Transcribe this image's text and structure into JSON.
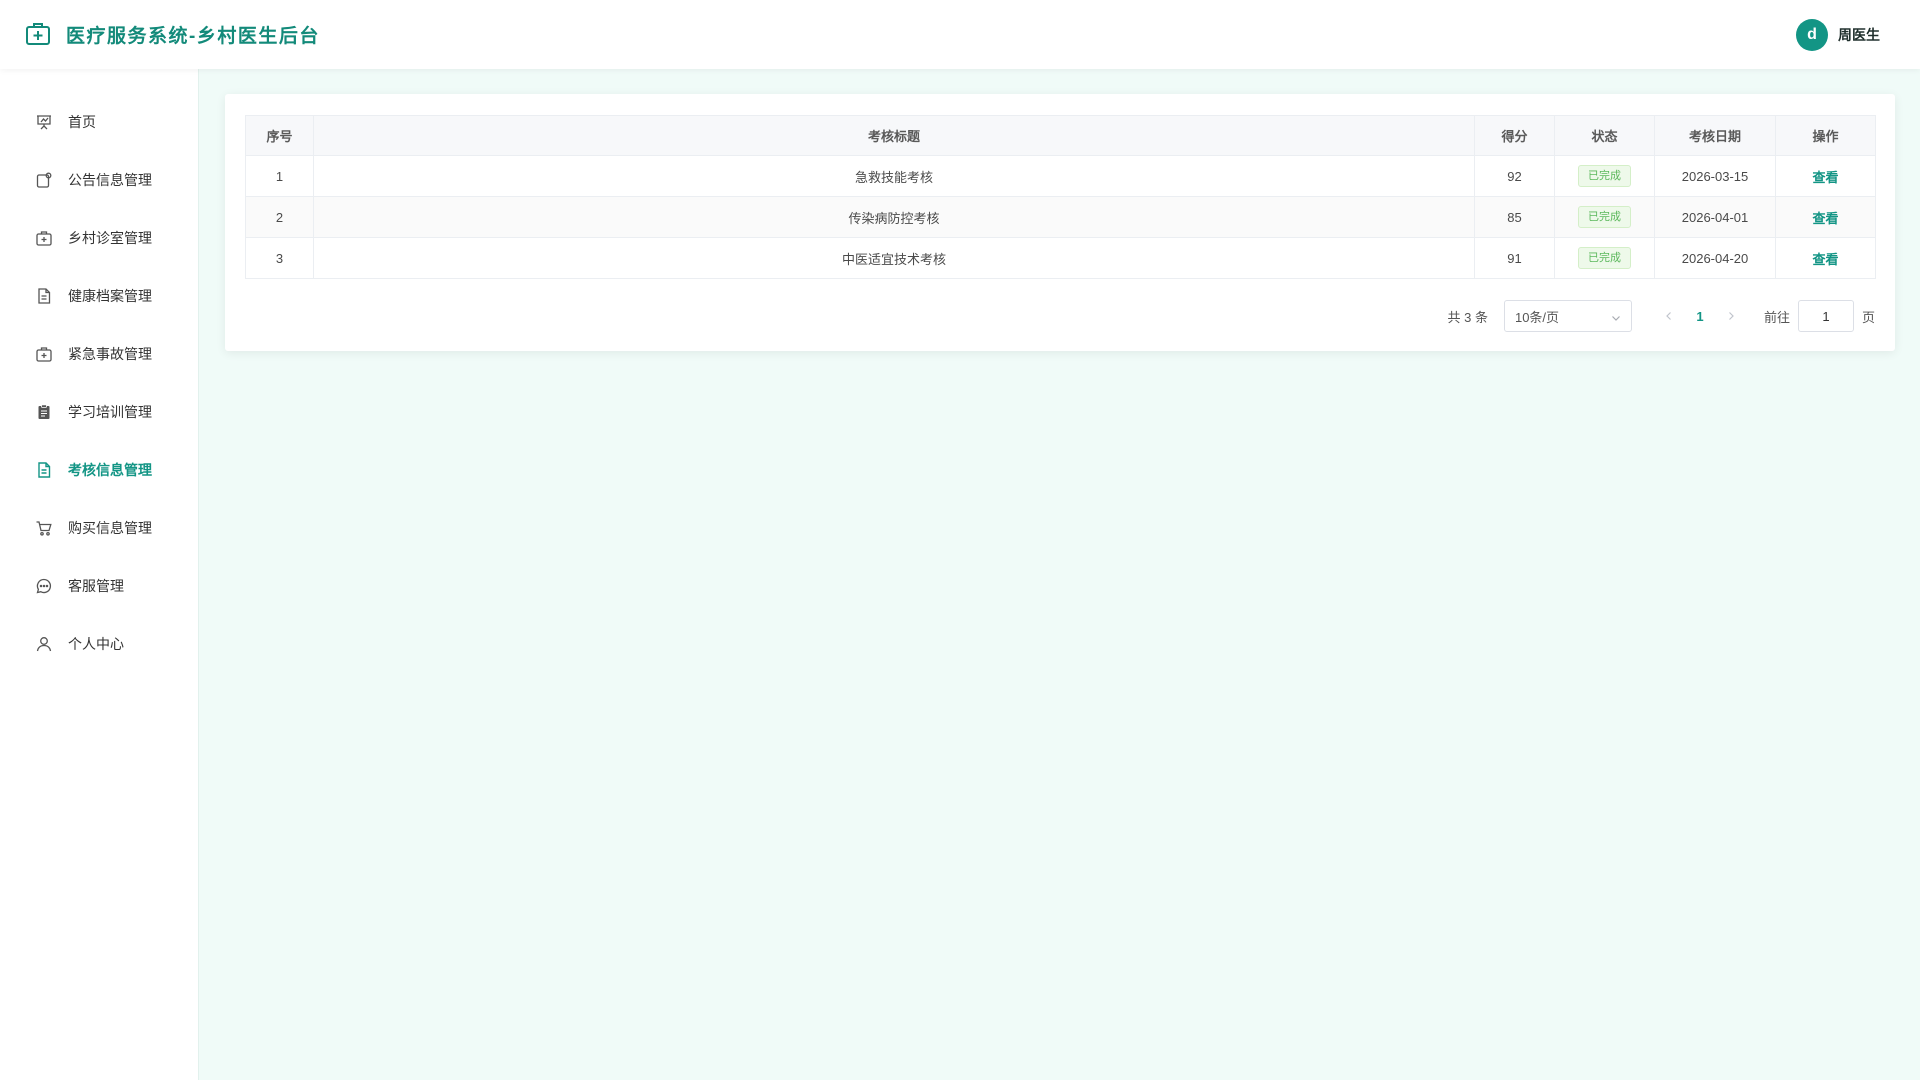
{
  "header": {
    "title": "医疗服务系统-乡村医生后台",
    "user": {
      "avatar_letter": "d",
      "name": "周医生"
    }
  },
  "sidebar": {
    "items": [
      {
        "label": "首页",
        "icon": "presentation-icon",
        "active": false
      },
      {
        "label": "公告信息管理",
        "icon": "notice-icon",
        "active": false
      },
      {
        "label": "乡村诊室管理",
        "icon": "medical-kit-icon",
        "active": false
      },
      {
        "label": "健康档案管理",
        "icon": "document-icon",
        "active": false
      },
      {
        "label": "紧急事故管理",
        "icon": "first-aid-icon",
        "active": false
      },
      {
        "label": "学习培训管理",
        "icon": "clipboard-icon",
        "active": false
      },
      {
        "label": "考核信息管理",
        "icon": "document-icon",
        "active": true
      },
      {
        "label": "购买信息管理",
        "icon": "cart-icon",
        "active": false
      },
      {
        "label": "客服管理",
        "icon": "chat-icon",
        "active": false
      },
      {
        "label": "个人中心",
        "icon": "user-icon",
        "active": false
      }
    ]
  },
  "table": {
    "headers": [
      "序号",
      "考核标题",
      "得分",
      "状态",
      "考核日期",
      "操作"
    ],
    "rows": [
      {
        "index": "1",
        "title": "急救技能考核",
        "score": "92",
        "status": "已完成",
        "date": "2026-03-15",
        "action": "查看"
      },
      {
        "index": "2",
        "title": "传染病防控考核",
        "score": "85",
        "status": "已完成",
        "date": "2026-04-01",
        "action": "查看"
      },
      {
        "index": "3",
        "title": "中医适宜技术考核",
        "score": "91",
        "status": "已完成",
        "date": "2026-04-20",
        "action": "查看"
      }
    ]
  },
  "pagination": {
    "total_text": "共 3 条",
    "page_size": "10条/页",
    "current_page": "1",
    "goto_label": "前往",
    "goto_value": "1",
    "page_suffix": "页"
  },
  "colors": {
    "accent": "#139585",
    "background": "#f0fbf8",
    "success_text": "#5cb85c"
  }
}
